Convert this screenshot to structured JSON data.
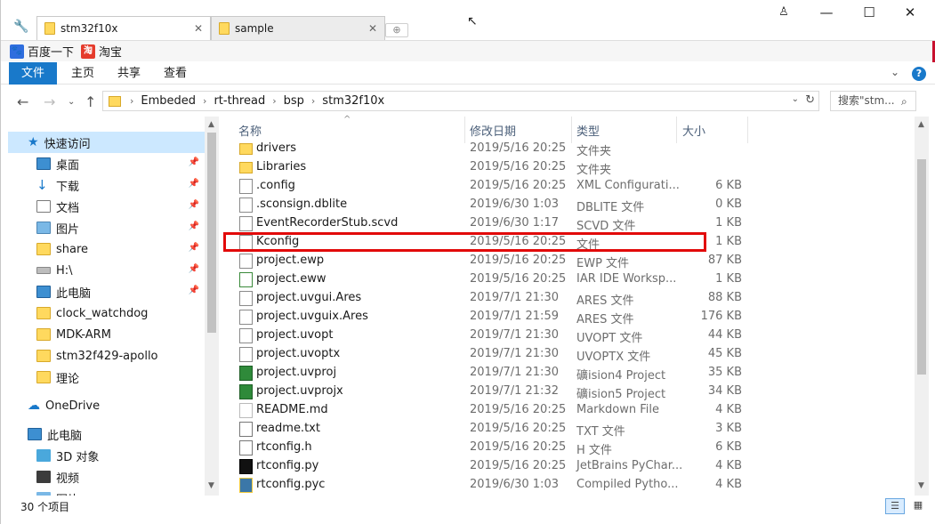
{
  "tabs": [
    {
      "label": "stm32f10x"
    },
    {
      "label": "sample"
    }
  ],
  "bookmarks": [
    {
      "label": "百度一下"
    },
    {
      "label": "淘宝"
    }
  ],
  "ribbon": {
    "file": "文件",
    "home": "主页",
    "share": "共享",
    "view": "查看"
  },
  "breadcrumb": [
    "Embeded",
    "rt-thread",
    "bsp",
    "stm32f10x"
  ],
  "search": {
    "placeholder": "搜索\"stm..."
  },
  "nav": {
    "quick_access": "快速访问",
    "items": [
      {
        "label": "桌面",
        "icon": "desktop-icon",
        "pinned": true
      },
      {
        "label": "下载",
        "icon": "download-icon",
        "pinned": true
      },
      {
        "label": "文档",
        "icon": "document-icon",
        "pinned": true
      },
      {
        "label": "图片",
        "icon": "picture-icon",
        "pinned": true
      },
      {
        "label": "share",
        "icon": "folder-icon",
        "pinned": true
      },
      {
        "label": "H:\\",
        "icon": "drive-icon",
        "pinned": true
      },
      {
        "label": "此电脑",
        "icon": "computer-icon",
        "pinned": true
      },
      {
        "label": "clock_watchdog",
        "icon": "folder-icon",
        "pinned": false
      },
      {
        "label": "MDK-ARM",
        "icon": "folder-icon",
        "pinned": false
      },
      {
        "label": "stm32f429-apollo",
        "icon": "folder-icon",
        "pinned": false
      },
      {
        "label": "理论",
        "icon": "folder-icon",
        "pinned": false
      }
    ],
    "onedrive": "OneDrive",
    "this_pc": "此电脑",
    "pc_items": [
      {
        "label": "3D 对象",
        "icon": "3d-objects-icon"
      },
      {
        "label": "视频",
        "icon": "video-icon"
      },
      {
        "label": "图片",
        "icon": "picture-icon"
      }
    ]
  },
  "columns": {
    "name": "名称",
    "date": "修改日期",
    "type": "类型",
    "size": "大小"
  },
  "files": [
    {
      "name": "drivers",
      "date": "2019/5/16 20:25",
      "type": "文件夹",
      "size": "",
      "icon": "folder-icon"
    },
    {
      "name": "Libraries",
      "date": "2019/5/16 20:25",
      "type": "文件夹",
      "size": "",
      "icon": "folder-icon"
    },
    {
      "name": ".config",
      "date": "2019/5/16 20:25",
      "type": "XML Configurati...",
      "size": "6 KB",
      "icon": "file-icon"
    },
    {
      "name": ".sconsign.dblite",
      "date": "2019/6/30 1:03",
      "type": "DBLITE 文件",
      "size": "0 KB",
      "icon": "file-icon"
    },
    {
      "name": "EventRecorderStub.scvd",
      "date": "2019/6/30 1:17",
      "type": "SCVD 文件",
      "size": "1 KB",
      "icon": "file-icon"
    },
    {
      "name": "Kconfig",
      "date": "2019/5/16 20:25",
      "type": "文件",
      "size": "1 KB",
      "icon": "file-icon"
    },
    {
      "name": "project.ewp",
      "date": "2019/5/16 20:25",
      "type": "EWP 文件",
      "size": "87 KB",
      "icon": "file-icon"
    },
    {
      "name": "project.eww",
      "date": "2019/5/16 20:25",
      "type": "IAR IDE Worksp...",
      "size": "1 KB",
      "icon": "iar-workspace-icon"
    },
    {
      "name": "project.uvgui.Ares",
      "date": "2019/7/1 21:30",
      "type": "ARES 文件",
      "size": "88 KB",
      "icon": "file-icon"
    },
    {
      "name": "project.uvguix.Ares",
      "date": "2019/7/1 21:59",
      "type": "ARES 文件",
      "size": "176 KB",
      "icon": "file-icon"
    },
    {
      "name": "project.uvopt",
      "date": "2019/7/1 21:30",
      "type": "UVOPT 文件",
      "size": "44 KB",
      "icon": "file-icon"
    },
    {
      "name": "project.uvoptx",
      "date": "2019/7/1 21:30",
      "type": "UVOPTX 文件",
      "size": "45 KB",
      "icon": "file-icon"
    },
    {
      "name": "project.uvproj",
      "date": "2019/7/1 21:30",
      "type": "礦ision4 Project",
      "size": "35 KB",
      "icon": "keil-project-icon"
    },
    {
      "name": "project.uvprojx",
      "date": "2019/7/1 21:32",
      "type": "礦ision5 Project",
      "size": "34 KB",
      "icon": "keil-project-icon"
    },
    {
      "name": "README.md",
      "date": "2019/5/16 20:25",
      "type": "Markdown File",
      "size": "4 KB",
      "icon": "markdown-icon"
    },
    {
      "name": "readme.txt",
      "date": "2019/5/16 20:25",
      "type": "TXT 文件",
      "size": "3 KB",
      "icon": "text-file-icon"
    },
    {
      "name": "rtconfig.h",
      "date": "2019/5/16 20:25",
      "type": "H 文件",
      "size": "6 KB",
      "icon": "header-file-icon"
    },
    {
      "name": "rtconfig.py",
      "date": "2019/5/16 20:25",
      "type": "JetBrains PyChar...",
      "size": "4 KB",
      "icon": "pycharm-icon"
    },
    {
      "name": "rtconfig.pyc",
      "date": "2019/6/30 1:03",
      "type": "Compiled Pytho...",
      "size": "4 KB",
      "icon": "python-compiled-icon"
    }
  ],
  "status": {
    "count": "30 个项目"
  },
  "colors": {
    "accent": "#1979ca",
    "highlight": "#e20a0a",
    "folder": "#ffd95e"
  }
}
